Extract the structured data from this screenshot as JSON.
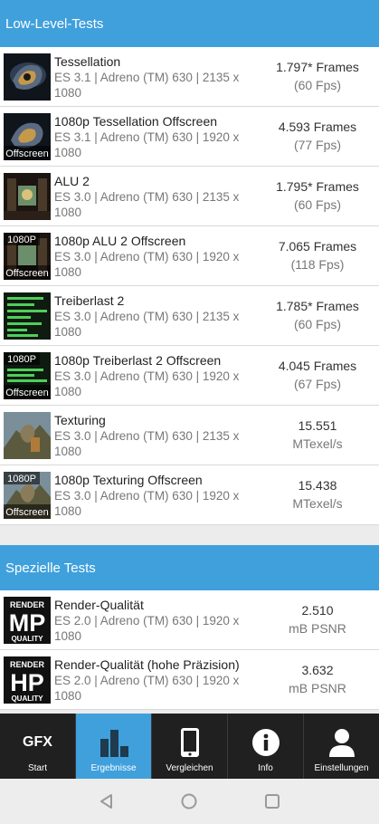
{
  "sections": {
    "low_level": "Low-Level-Tests",
    "special": "Spezielle Tests"
  },
  "tests": [
    {
      "name": "Tessellation",
      "api": "ES 3.1 | Adreno (TM) 630 | 2135 x 1080",
      "value": "1.797* Frames",
      "sub": "(60 Fps)",
      "badge": "",
      "icon": "tessellation-thumbnail-icon"
    },
    {
      "name": "1080p Tessellation Offscreen",
      "api": "ES 3.1 | Adreno (TM) 630 | 1920 x 1080",
      "value": "4.593 Frames",
      "sub": "(77 Fps)",
      "badge": "Offscreen",
      "icon": "tessellation-offscreen-thumbnail-icon"
    },
    {
      "name": "ALU 2",
      "api": "ES 3.0 | Adreno (TM) 630 | 2135 x 1080",
      "value": "1.795* Frames",
      "sub": "(60 Fps)",
      "badge": "",
      "icon": "alu2-thumbnail-icon"
    },
    {
      "name": "1080p ALU 2 Offscreen",
      "api": "ES 3.0 | Adreno (TM) 630 | 1920 x 1080",
      "value": "7.065 Frames",
      "sub": "(118 Fps)",
      "badge": "1080P|Offscreen",
      "icon": "alu2-offscreen-thumbnail-icon"
    },
    {
      "name": "Treiberlast 2",
      "api": "ES 3.0 | Adreno (TM) 630 | 2135 x 1080",
      "value": "1.785* Frames",
      "sub": "(60 Fps)",
      "badge": "",
      "icon": "driver-overhead-thumbnail-icon"
    },
    {
      "name": "1080p Treiberlast 2 Offscreen",
      "api": "ES 3.0 | Adreno (TM) 630 | 1920 x 1080",
      "value": "4.045 Frames",
      "sub": "(67 Fps)",
      "badge": "1080P|Offscreen",
      "icon": "driver-overhead-offscreen-thumbnail-icon"
    },
    {
      "name": "Texturing",
      "api": "ES 3.0 | Adreno (TM) 630 | 2135 x 1080",
      "value": "15.551",
      "sub": "MTexel/s",
      "badge": "",
      "icon": "texturing-thumbnail-icon"
    },
    {
      "name": "1080p Texturing Offscreen",
      "api": "ES 3.0 | Adreno (TM) 630 | 1920 x 1080",
      "value": "15.438",
      "sub": "MTexel/s",
      "badge": "1080P|Offscreen",
      "icon": "texturing-offscreen-thumbnail-icon"
    }
  ],
  "special_tests": [
    {
      "name": "Render-Qualität",
      "api": "ES 2.0 | Adreno (TM) 630 | 1920 x 1080",
      "value": "2.510",
      "sub": "mB PSNR",
      "tile": {
        "top": "RENDER",
        "big": "MP",
        "bottom": "QUALITY"
      },
      "icon": "render-quality-mp-icon"
    },
    {
      "name": "Render-Qualität (hohe Präzision)",
      "api": "ES 2.0 | Adreno (TM) 630 | 1920 x 1080",
      "value": "3.632",
      "sub": "mB PSNR",
      "tile": {
        "top": "RENDER",
        "big": "HP",
        "bottom": "QUALITY"
      },
      "icon": "render-quality-hp-icon"
    }
  ],
  "nav": {
    "start": {
      "label": "Start",
      "logo": "GFX",
      "icon": "gfx-logo-icon"
    },
    "results": {
      "label": "Ergebnisse",
      "icon": "bar-chart-icon"
    },
    "compare": {
      "label": "Vergleichen",
      "icon": "phone-icon"
    },
    "info": {
      "label": "Info",
      "icon": "info-icon"
    },
    "settings": {
      "label": "Einstellungen",
      "icon": "person-icon"
    }
  },
  "colors": {
    "accent": "#3fa0dc",
    "nav_bg": "#202020",
    "text": "#222222",
    "muted": "#777777"
  }
}
